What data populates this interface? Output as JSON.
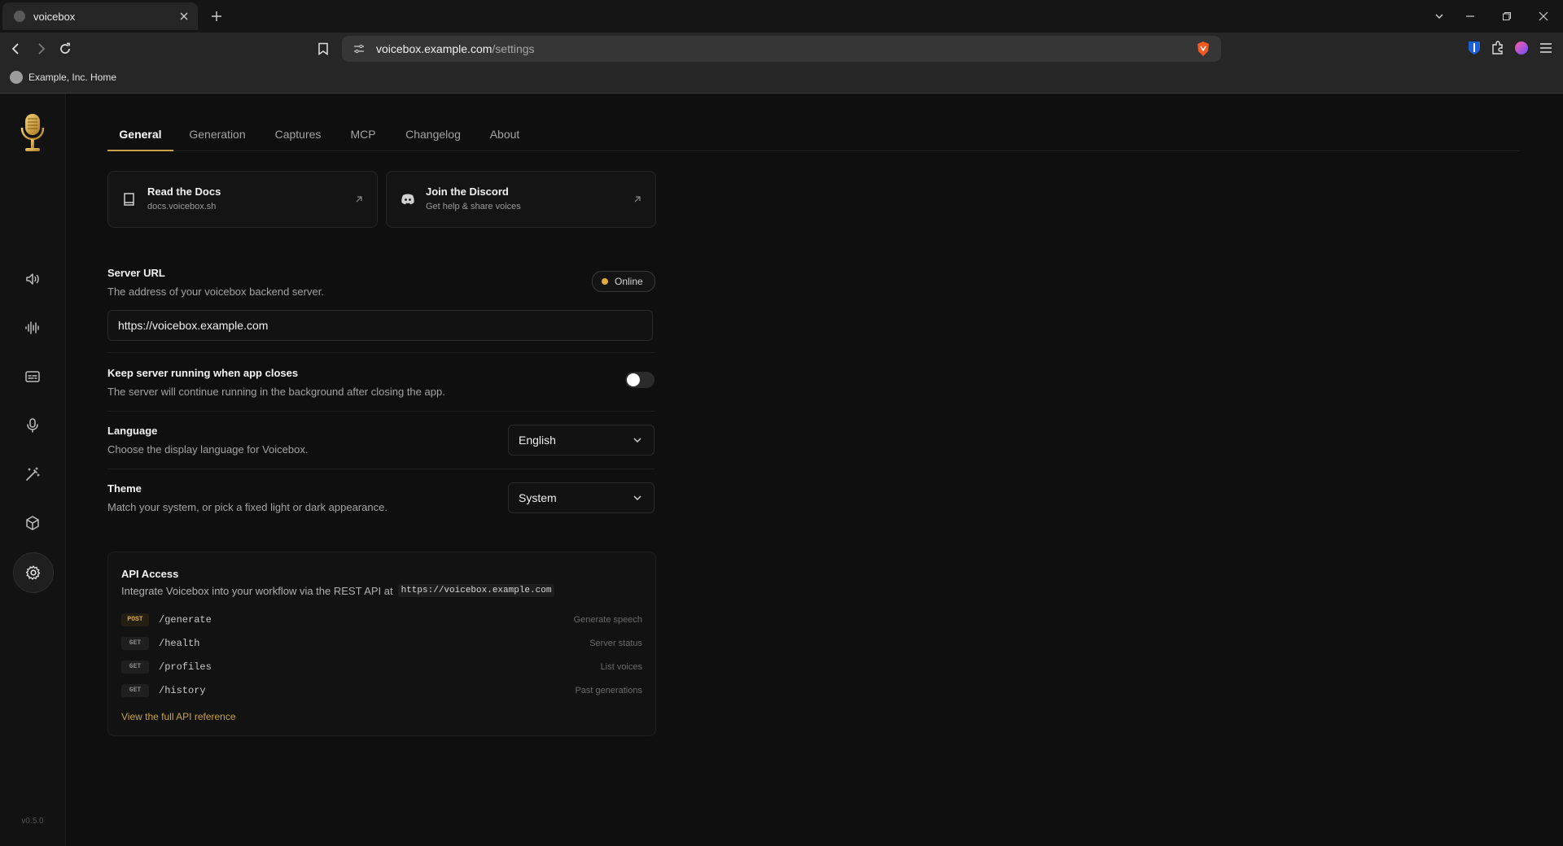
{
  "browser": {
    "tab_title": "voicebox",
    "url_host": "voicebox.example.com",
    "url_path": "/settings",
    "bookmark": "Example, Inc. Home"
  },
  "sidebar": {
    "items": [
      {
        "icon": "speaker-icon"
      },
      {
        "icon": "waveform-icon"
      },
      {
        "icon": "captions-icon"
      },
      {
        "icon": "microphone-icon"
      },
      {
        "icon": "magic-wand-icon"
      },
      {
        "icon": "box-icon"
      },
      {
        "icon": "gear-icon",
        "active": true
      }
    ],
    "version": "v0.5.0"
  },
  "tabs": [
    "General",
    "Generation",
    "Captures",
    "MCP",
    "Changelog",
    "About"
  ],
  "active_tab": "General",
  "links": [
    {
      "title": "Read the Docs",
      "subtitle": "docs.voicebox.sh",
      "icon": "book-icon"
    },
    {
      "title": "Join the Discord",
      "subtitle": "Get help & share voices",
      "icon": "discord-icon"
    }
  ],
  "server": {
    "label": "Server URL",
    "description": "The address of your voicebox backend server.",
    "status": "Online",
    "value": "https://voicebox.example.com"
  },
  "keep_running": {
    "label": "Keep server running when app closes",
    "description": "The server will continue running in the background after closing the app.",
    "enabled": false
  },
  "language": {
    "label": "Language",
    "description": "Choose the display language for Voicebox.",
    "value": "English"
  },
  "theme": {
    "label": "Theme",
    "description": "Match your system, or pick a fixed light or dark appearance.",
    "value": "System"
  },
  "api": {
    "title": "API Access",
    "intro": "Integrate Voicebox into your workflow via the REST API at",
    "base_url": "https://voicebox.example.com",
    "endpoints": [
      {
        "method": "POST",
        "path": "/generate",
        "summary": "Generate speech"
      },
      {
        "method": "GET",
        "path": "/health",
        "summary": "Server status"
      },
      {
        "method": "GET",
        "path": "/profiles",
        "summary": "List voices"
      },
      {
        "method": "GET",
        "path": "/history",
        "summary": "Past generations"
      }
    ],
    "reference_link": "View the full API reference"
  },
  "colors": {
    "accent": "#c9a24a",
    "status_online": "#e2a93b",
    "background": "#0f0f0f"
  }
}
